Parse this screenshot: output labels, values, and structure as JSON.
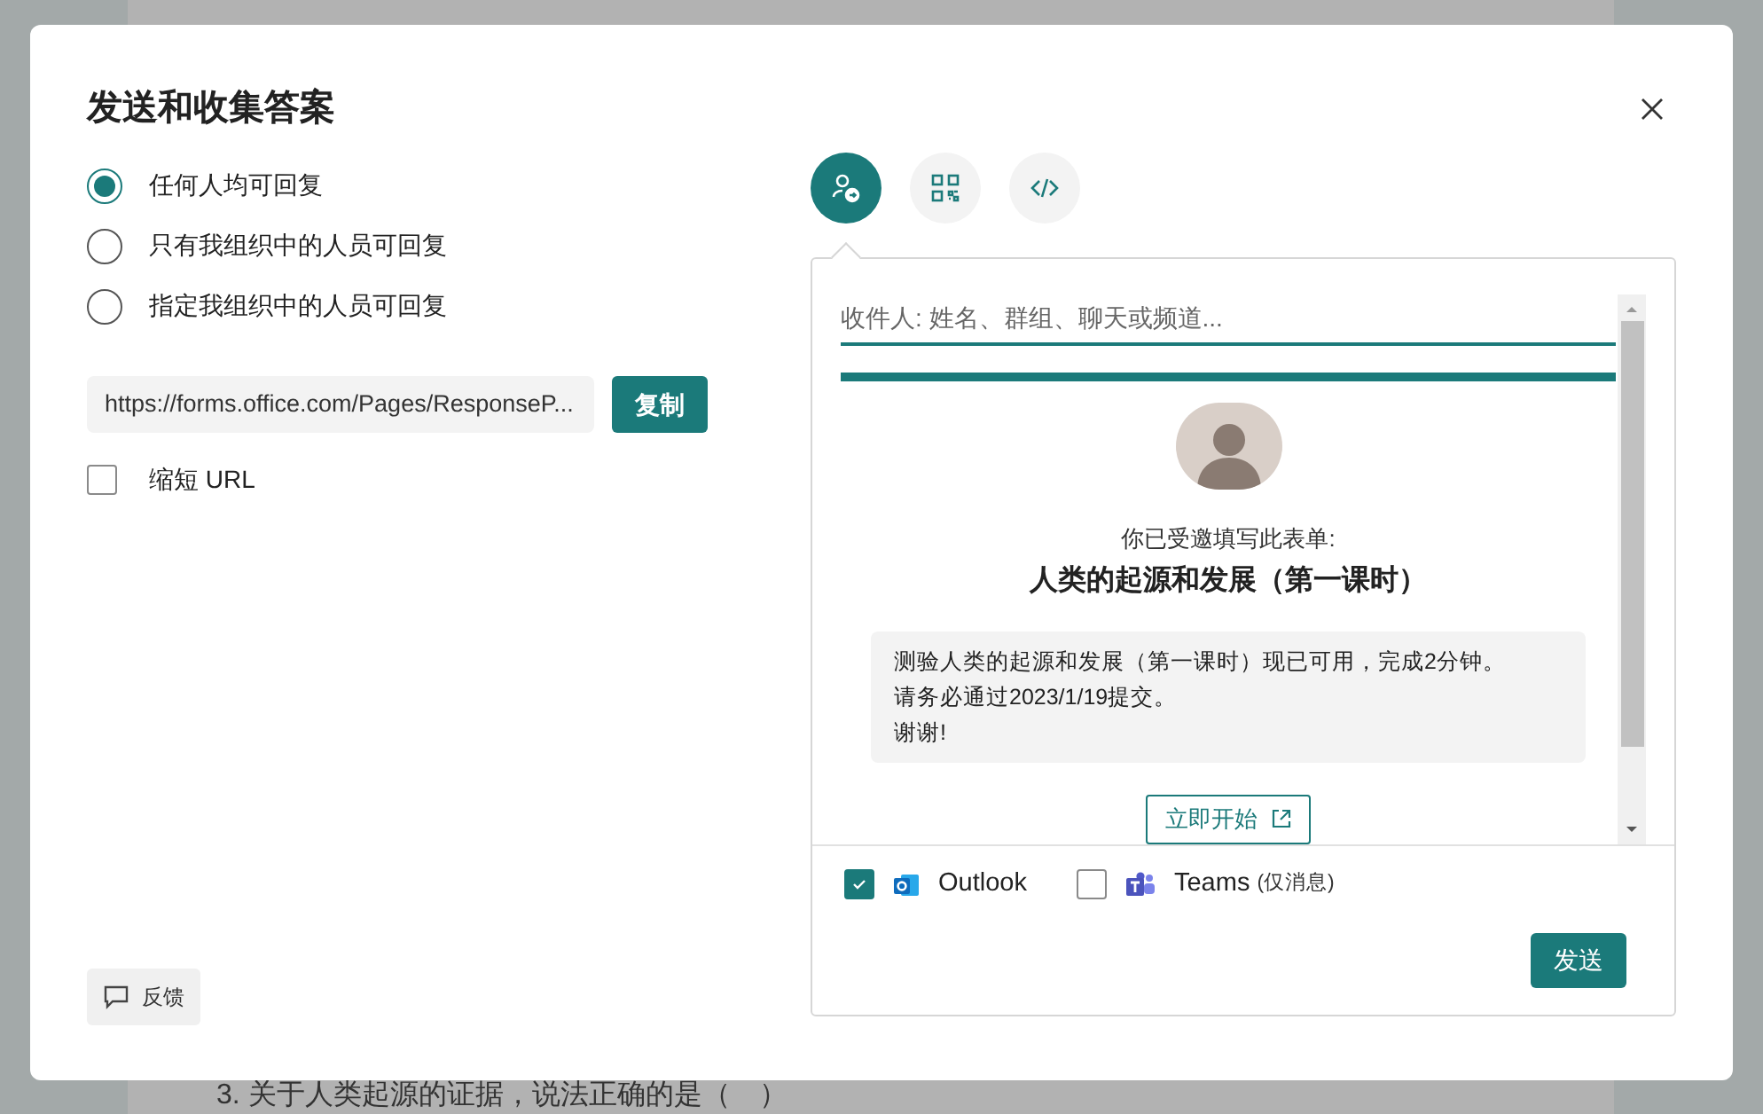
{
  "background": {
    "question": "3. 关于人类起源的证据，说法正确的是（　）"
  },
  "dialog": {
    "title": "发送和收集答案",
    "audience_options": [
      {
        "label": "任何人均可回复",
        "selected": true
      },
      {
        "label": "只有我组织中的人员可回复",
        "selected": false
      },
      {
        "label": "指定我组织中的人员可回复",
        "selected": false
      }
    ],
    "link": {
      "url": "https://forms.office.com/Pages/ResponseP...",
      "copy_button": "复制"
    },
    "shorten_url": {
      "label": "缩短 URL",
      "checked": false
    },
    "feedback_button": "反馈",
    "share_tabs": [
      {
        "kind": "email",
        "selected": true
      },
      {
        "kind": "qr",
        "selected": false
      },
      {
        "kind": "embed",
        "selected": false
      }
    ],
    "email": {
      "recipient_placeholder": "收件人: 姓名、群组、聊天或频道...",
      "invite_line": "你已受邀填写此表单:",
      "form_title": "人类的起源和发展（第一课时）",
      "message_lines": [
        "测验人类的起源和发展（第一课时）现已可用，完成2分钟。",
        "请务必通过2023/1/19提交。",
        "谢谢!"
      ],
      "start_button": "立即开始",
      "channels": [
        {
          "kind": "outlook",
          "label": "Outlook",
          "checked": true
        },
        {
          "kind": "teams",
          "label": "Teams",
          "note": "(仅消息)",
          "checked": false
        }
      ],
      "send_button": "发送"
    }
  }
}
